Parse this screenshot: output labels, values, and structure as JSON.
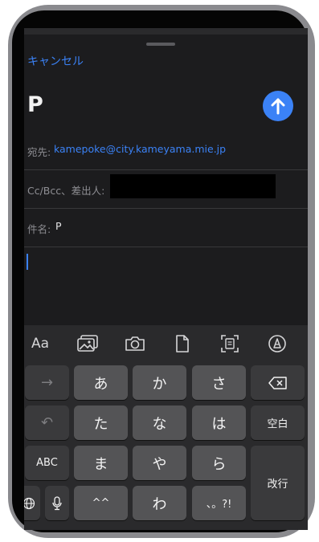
{
  "compose": {
    "cancel_label": "キャンセル",
    "subject_title": "P",
    "to_label": "宛先:",
    "to_value": "kamepoke@city.kameyama.mie.jp",
    "cc_label": "Cc/Bcc、差出人:",
    "subject_label": "件名:",
    "subject_value": "P"
  },
  "keyboard": {
    "toolbar": [
      {
        "icon": "text-format-icon",
        "label": "Aa"
      },
      {
        "icon": "photo-library-icon"
      },
      {
        "icon": "camera-icon"
      },
      {
        "icon": "document-icon"
      },
      {
        "icon": "scan-document-icon"
      },
      {
        "icon": "markup-pen-icon"
      }
    ],
    "keys": {
      "arrow": "→",
      "a": "あ",
      "ka": "か",
      "sa": "さ",
      "undo": "↶",
      "ta": "た",
      "na": "な",
      "ha": "は",
      "space": "空白",
      "abc": "ABC",
      "ma": "ま",
      "ya": "や",
      "ra": "ら",
      "return": "改行",
      "dakuten": "^^",
      "wa": "わ",
      "punct": "、。?!"
    }
  },
  "colors": {
    "accent": "#3b82f6",
    "background": "#1c1c1e",
    "key": "#545456",
    "key_dark": "#3a3a3c"
  }
}
